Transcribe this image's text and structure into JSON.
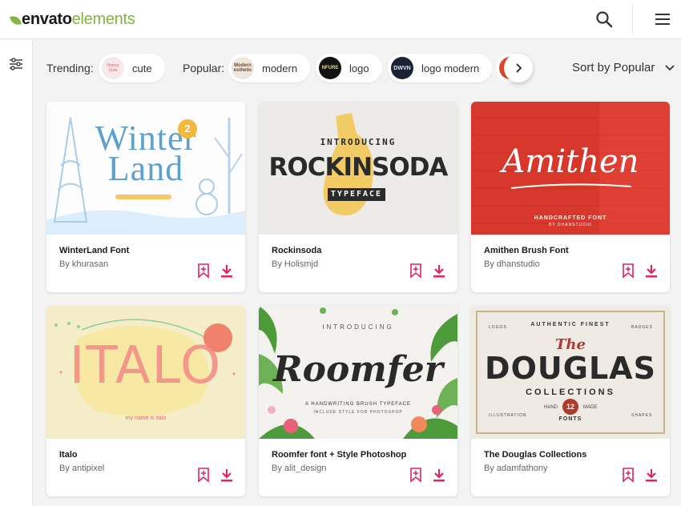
{
  "header": {
    "logo": {
      "part1": "envato",
      "part2": "elements"
    },
    "icons": {
      "search": "search-icon",
      "menu": "hamburger-menu-icon"
    }
  },
  "sidebar": {
    "filter_icon": "filter-sliders-icon"
  },
  "filters": {
    "trending_label": "Trending:",
    "trending": [
      {
        "label": "cute",
        "thumb_text": "Honey Cute"
      }
    ],
    "popular_label": "Popular:",
    "popular": [
      {
        "label": "modern",
        "thumb_text": "Modern esthetic"
      },
      {
        "label": "logo",
        "thumb_text": "NFURE"
      },
      {
        "label": "logo modern",
        "thumb_text": "DWVN"
      }
    ],
    "next_icon": "chevron-right-icon",
    "sort_label": "Sort by Popular",
    "sort_icon": "chevron-down-icon"
  },
  "colors": {
    "brand_green": "#82b541",
    "action_red": "#e0245e"
  },
  "cards": [
    {
      "title": "WinterLand Font",
      "author": "By khurasan",
      "preview": {
        "main": "Winter Land",
        "line1": "Winter",
        "line2": "Land",
        "badge": "2"
      }
    },
    {
      "title": "Rockinsoda",
      "author": "By Holismjd",
      "preview": {
        "top": "INTRODUCING",
        "main": "ROCKINSODA",
        "sub": "TYPEFACE"
      }
    },
    {
      "title": "Amithen Brush Font",
      "author": "By dhanstudio",
      "preview": {
        "main": "Amithen",
        "sub": "HANDCRAFTED FONT",
        "credit": "BY DHANSTUDIO"
      }
    },
    {
      "title": "Italo",
      "author": "By antipixel",
      "preview": {
        "main": "ITALO",
        "sub": "my name is italo"
      }
    },
    {
      "title": "Roomfer font + Style Photoshop",
      "author": "By alit_design",
      "preview": {
        "top": "INTRODUCING",
        "main": "Roomfer",
        "sub": "A HANDWRITING BRUSH TYPEFACE",
        "sub2": "INCLUDE STYLE FOR PHOTOSHOP"
      }
    },
    {
      "title": "The Douglas Collections",
      "author": "By adamfathony",
      "preview": {
        "arc": "AUTHENTIC FINEST",
        "logos": "LOGOS",
        "badges": "BADGES",
        "the": "The",
        "main": "DOUGLAS",
        "sub": "COLLECTIONS",
        "hand": "HAND",
        "made": "MADE",
        "num": "12",
        "fonts": "FONTS",
        "illus": "ILLUSTRATION",
        "shapes": "SHAPES"
      }
    }
  ],
  "card_icons": {
    "bookmark": "bookmark-add-icon",
    "download": "download-icon"
  }
}
